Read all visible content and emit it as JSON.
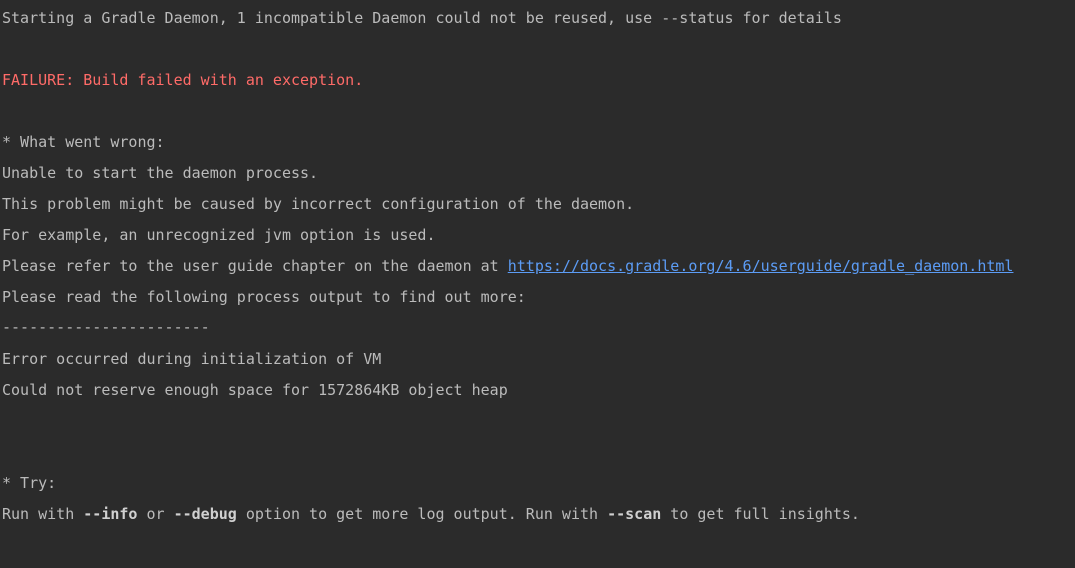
{
  "console": {
    "daemon_start": "Starting a Gradle Daemon, 1 incompatible Daemon could not be reused, use --status for details",
    "failure": "FAILURE: Build failed with an exception.",
    "what_went_wrong": "* What went wrong:",
    "unable_to_start": "Unable to start the daemon process.",
    "problem_caused": "This problem might be caused by incorrect configuration of the daemon.",
    "for_example": "For example, an unrecognized jvm option is used.",
    "refer_prefix": "Please refer to the user guide chapter on the daemon at ",
    "refer_link": "https://docs.gradle.org/4.6/userguide/gradle_daemon.html",
    "read_following": "Please read the following process output to find out more:",
    "separator": "-----------------------",
    "error_vm": "Error occurred during initialization of VM",
    "heap_error": "Could not reserve enough space for 1572864KB object heap",
    "try_header": "* Try:",
    "run_with_1": "Run with ",
    "opt_info": "--info",
    "or_text": " or ",
    "opt_debug": "--debug",
    "run_with_2": " option to get more log output. Run with ",
    "opt_scan": "--scan",
    "run_with_3": " to get full insights."
  },
  "colors": {
    "background": "#2b2b2b",
    "text": "#bbbbbb",
    "failure": "#ff6b68",
    "link": "#5c9cf5"
  }
}
